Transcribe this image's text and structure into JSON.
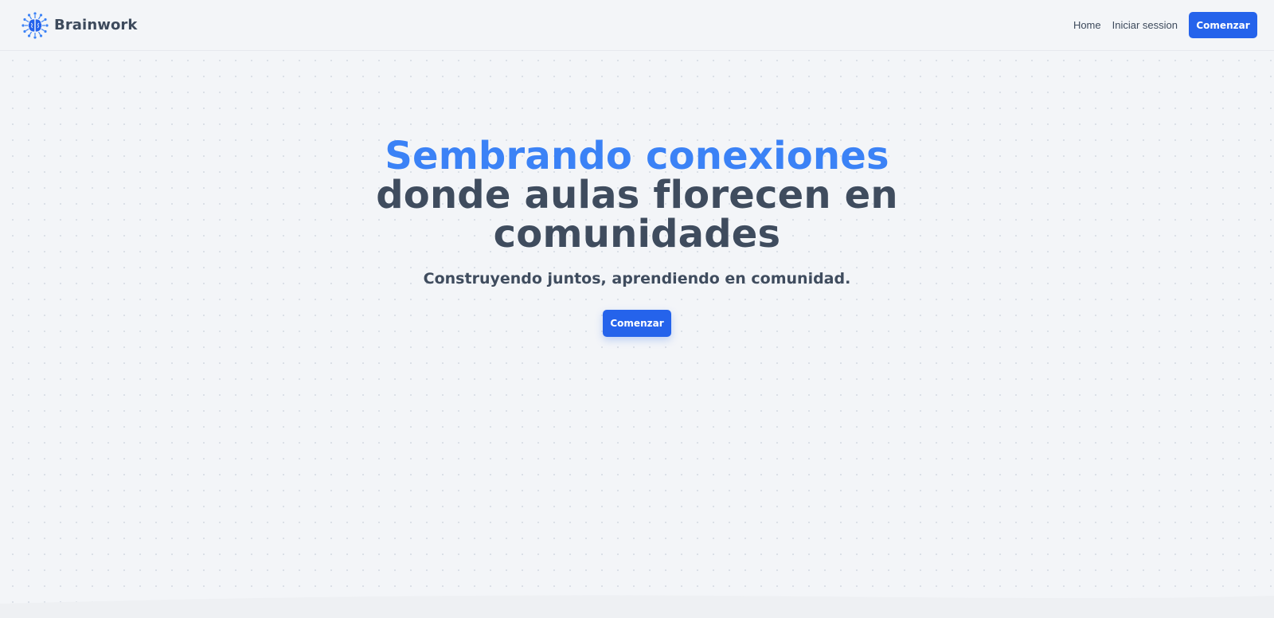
{
  "brand": {
    "name": "Brainwork",
    "icon": "brain-network-icon",
    "accent": "#3b82f6"
  },
  "nav": {
    "links": [
      "Home",
      "Iniciar session"
    ],
    "cta_label": "Comenzar"
  },
  "hero": {
    "title_accent": "Sembrando conexiones",
    "title_rest_1": "donde aulas florecen en",
    "title_rest_2": "comunidades",
    "subtitle": "Construyendo juntos, aprendiendo en comunidad.",
    "cta_label": "Comenzar"
  },
  "colors": {
    "primary_button": "#2563eb",
    "heading_accent": "#3b82f6",
    "text_dark": "#3f4c5e",
    "background": "#f3f5f8"
  }
}
